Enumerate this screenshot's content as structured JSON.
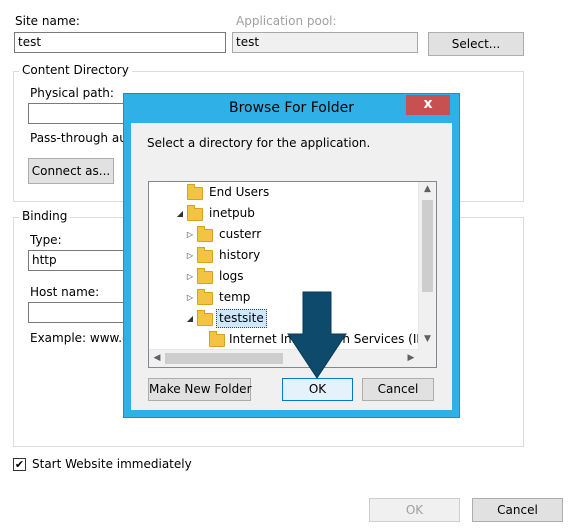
{
  "site": {
    "site_name_label": "Site name:",
    "site_name_value": "test",
    "app_pool_label": "Application pool:",
    "app_pool_value": "test",
    "select_button": "Select..."
  },
  "content_dir": {
    "title": "Content Directory",
    "physical_path_label": "Physical path:",
    "passthrough_label": "Pass-through auth",
    "connect_as_button": "Connect as..."
  },
  "binding": {
    "title": "Binding",
    "type_label": "Type:",
    "type_value": "http",
    "host_label": "Host name:",
    "example": "Example: www.co"
  },
  "start_website": {
    "label": "Start Website immediately",
    "checked": true
  },
  "footer": {
    "ok": "OK",
    "cancel": "Cancel"
  },
  "dialog": {
    "title": "Browse For Folder",
    "close": "x",
    "instruction": "Select a directory for the application.",
    "tree": [
      {
        "label": "End Users",
        "expander": ""
      },
      {
        "label": "inetpub",
        "expander": "◢"
      },
      {
        "label": "custerr",
        "expander": "▷"
      },
      {
        "label": "history",
        "expander": "▷"
      },
      {
        "label": "logs",
        "expander": "▷"
      },
      {
        "label": "temp",
        "expander": "▷"
      },
      {
        "label": "testsite",
        "expander": "◢"
      },
      {
        "label": "Internet Information Services (IIS) In",
        "expander": ""
      }
    ],
    "make_new_folder": "Make New Folder",
    "ok": "OK",
    "cancel": "Cancel"
  },
  "colors": {
    "dialog_border": "#2fb1e8",
    "close_button": "#c75050",
    "arrow": "#0d4a6b"
  }
}
